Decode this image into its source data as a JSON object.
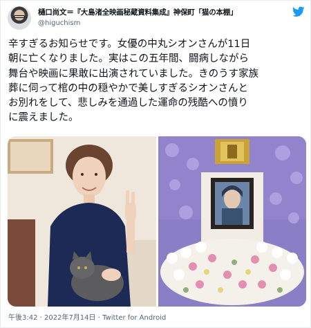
{
  "tweet": {
    "author_name": "樋口尚文＝『大島渚全映画秘蔵資料集成』神保町「猫の本棚」",
    "handle": "@higuchism",
    "text_lines": [
      "辛すぎるお知らせです。女優の中丸シオンさんが11日",
      "朝に亡くなりました。実はこの五年間、闘病しながら",
      "舞台や映画に果敢に出演されていました。きのうす家族",
      "葬に伺って棺の中の穏やかで美しすぎるシオンさんと",
      "お別れをして、悲しみを通過した運命の残酷への憤り",
      "に震えました。"
    ],
    "footer": "午後3:42 · 2022年7月14日 · Twitter for Android"
  },
  "media": {
    "left_photo": "woman-with-cat-peace-sign-photo",
    "right_photo": "funeral-altar-flowers-portrait-photo"
  },
  "colors": {
    "text": "#0f1419",
    "secondary": "#536471",
    "twitter_blue": "#1d9bf0"
  },
  "icons": [
    "twitter-bird-icon"
  ]
}
